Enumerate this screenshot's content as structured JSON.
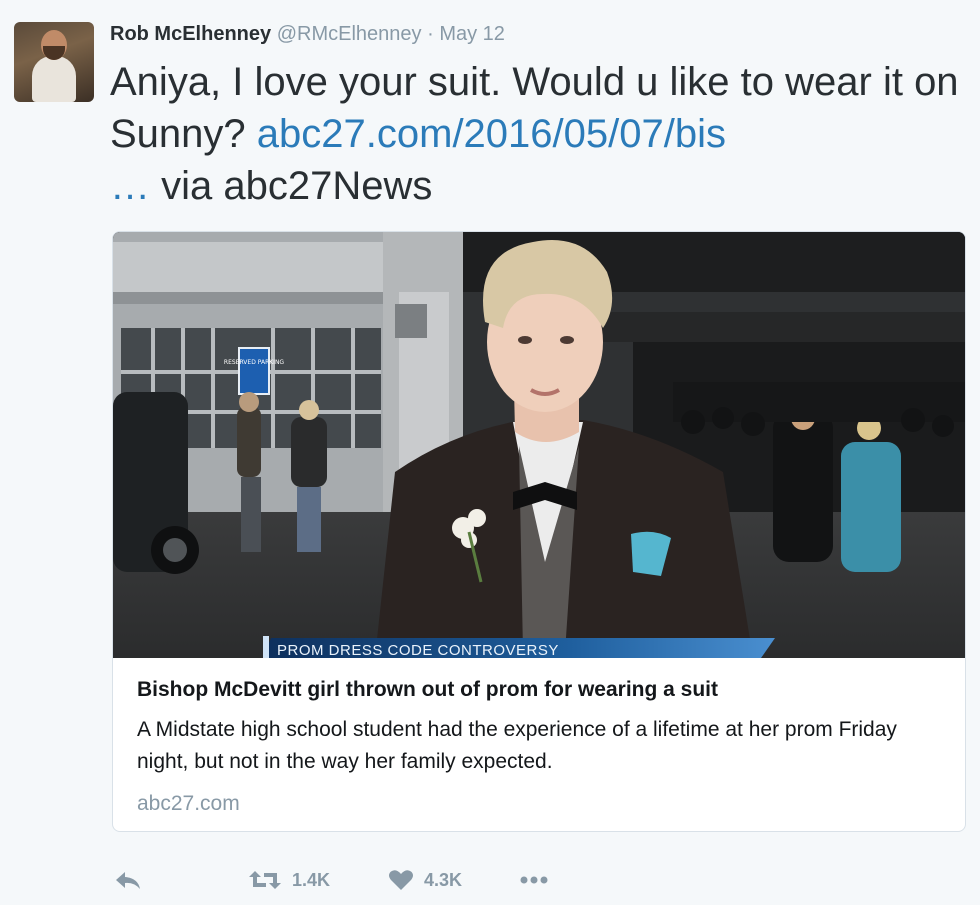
{
  "tweet": {
    "author_name": "Rob McElhenney",
    "handle": "@RMcElhenney",
    "separator": "·",
    "date": "May 12",
    "text_before_link": "Aniya, I love your suit. Would u like to wear it on Sunny? ",
    "link_text": "abc27.com/2016/05/07/bis",
    "ellipsis": "…",
    "text_after_link": " via abc27News"
  },
  "card": {
    "image_banner": "PROM DRESS CODE CONTROVERSY",
    "sign_text": "RESERVED PARKING",
    "title": "Bishop McDevitt girl thrown out of prom for wearing a suit",
    "description": "A Midstate high school student had the experience of a lifetime at her prom Friday night, but not in the way her family expected.",
    "domain": "abc27.com"
  },
  "actions": {
    "retweet_count": "1.4K",
    "like_count": "4.3K"
  },
  "icons": {
    "reply": "reply-icon",
    "retweet": "retweet-icon",
    "like": "heart-icon",
    "more": "more-icon"
  },
  "colors": {
    "link": "#2b7bb9",
    "muted": "#8899a6",
    "background": "#f5f8fa",
    "banner": "#1f5f9e"
  }
}
